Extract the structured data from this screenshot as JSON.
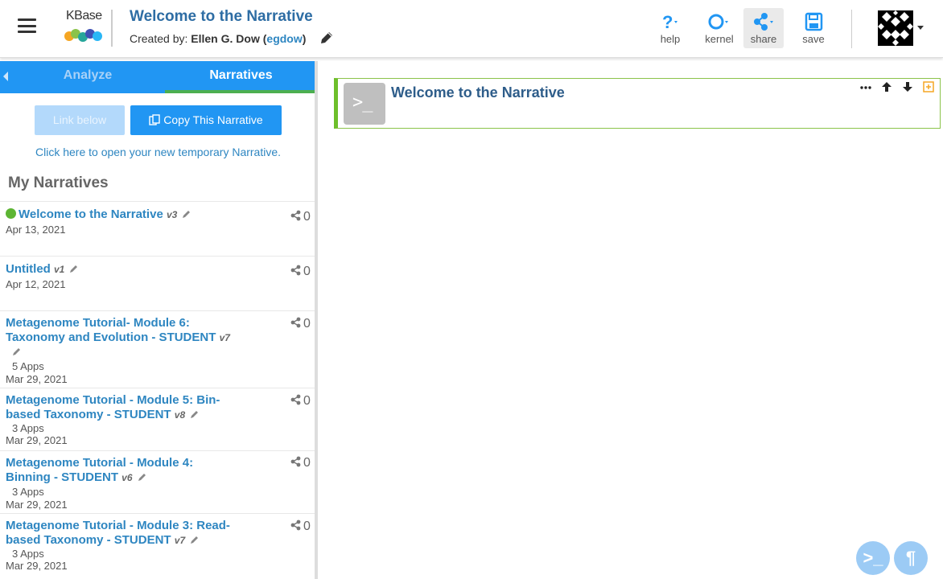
{
  "header": {
    "logo_text": "KBase",
    "title": "Welcome to the Narrative",
    "created_prefix": "Created by:",
    "author_name": "Ellen G. Dow",
    "author_username": "egdow",
    "buttons": [
      {
        "label": "help",
        "icon": "help-icon"
      },
      {
        "label": "kernel",
        "icon": "kernel-icon"
      },
      {
        "label": "share",
        "icon": "share-icon"
      },
      {
        "label": "save",
        "icon": "save-icon"
      }
    ]
  },
  "side_panel": {
    "tabs": [
      "Analyze",
      "Narratives"
    ],
    "active_tab": "Narratives",
    "link_button": "Link below",
    "copy_button": "Copy This Narrative",
    "open_link": "Click here to open your new temporary Narrative.",
    "section_title": "My Narratives",
    "narratives": [
      {
        "title": "Welcome to the Narrative",
        "version": "v3",
        "apps": "",
        "date": "Apr 13, 2021",
        "shares": "0",
        "active": true
      },
      {
        "title": "Untitled",
        "version": "v1",
        "apps": "",
        "date": "Apr 12, 2021",
        "shares": "0",
        "active": false
      },
      {
        "title": "Metagenome Tutorial- Module 6: Taxonomy and Evolution - STUDENT",
        "version": "v7",
        "apps": "5 Apps",
        "date": "Mar 29, 2021",
        "shares": "0",
        "active": false
      },
      {
        "title": "Metagenome Tutorial - Module 5: Bin-based Taxonomy - STUDENT",
        "version": "v8",
        "apps": "3 Apps",
        "date": "Mar 29, 2021",
        "shares": "0",
        "active": false
      },
      {
        "title": "Metagenome Tutorial - Module 4: Binning - STUDENT",
        "version": "v6",
        "apps": "3 Apps",
        "date": "Mar 29, 2021",
        "shares": "0",
        "active": false
      },
      {
        "title": "Metagenome Tutorial - Module 3: Read-based Taxonomy - STUDENT",
        "version": "v7",
        "apps": "3 Apps",
        "date": "Mar 29, 2021",
        "shares": "0",
        "active": false
      }
    ]
  },
  "main": {
    "cell_title": "Welcome to the Narrative",
    "cell_icon_glyph": ">_",
    "fab_code_glyph": ">_",
    "fab_markdown_glyph": "¶"
  },
  "colors": {
    "brand_blue": "#2196f3",
    "active_tab_underline": "#4caf50",
    "link_blue": "#2e86c1",
    "cell_border": "#6dbf2b"
  }
}
